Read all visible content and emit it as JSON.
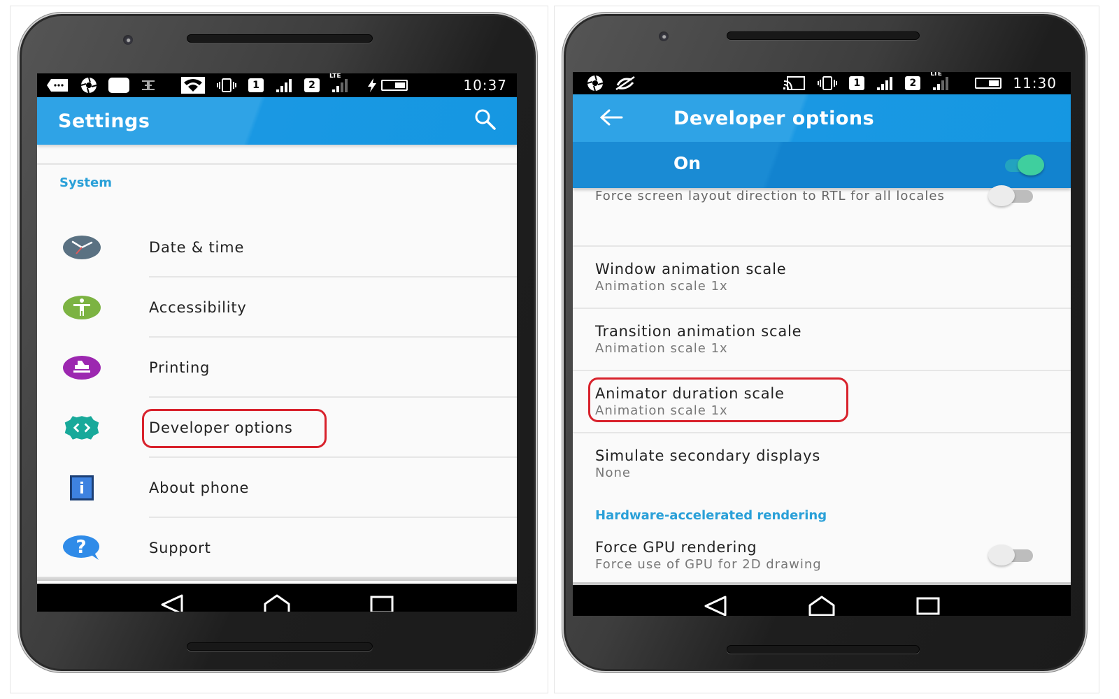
{
  "left_phone": {
    "status_bar": {
      "icons": [
        "more-icon",
        "aperture-icon",
        "blank-notification-icon",
        "usb-debug-icon",
        "wifi-icon",
        "vibrate-icon",
        "sim-1-icon",
        "signal-icon",
        "sim-2-icon",
        "lte-signal-icon",
        "charging-icon",
        "battery-icon"
      ],
      "sim1": "1",
      "sim2": "2",
      "lte": "LTE",
      "time": "10:37"
    },
    "app_bar": {
      "title": "Settings",
      "search_icon": "search-icon"
    },
    "section_header": "System",
    "items": [
      {
        "label": "Date & time",
        "icon": "clock-icon",
        "color": "#5a7182"
      },
      {
        "label": "Accessibility",
        "icon": "accessibility-icon",
        "color": "#7cb342"
      },
      {
        "label": "Printing",
        "icon": "printer-icon",
        "color": "#9c27b0"
      },
      {
        "label": "Developer options",
        "icon": "developer-options-icon",
        "color": "#18a99a",
        "highlighted": true
      },
      {
        "label": "About phone",
        "icon": "info-icon",
        "color": "#2d6bd0"
      },
      {
        "label": "Support",
        "icon": "help-icon",
        "color": "#2f8be8"
      }
    ],
    "nav": {
      "back": "back-icon",
      "home": "home-icon",
      "recents": "recents-icon"
    }
  },
  "right_phone": {
    "status_bar": {
      "icons": [
        "aperture-icon",
        "no-sync-icon",
        "cast-icon",
        "vibrate-icon",
        "sim-1-icon",
        "signal-icon",
        "sim-2-icon",
        "lte-signal-icon",
        "battery-icon"
      ],
      "sim1": "1",
      "sim2": "2",
      "lte": "LTE",
      "time": "11:30"
    },
    "app_bar": {
      "title": "Developer options",
      "back_icon": "back-arrow-icon"
    },
    "master_switch": {
      "label": "On",
      "enabled": true
    },
    "partial_item": {
      "title": "Force screen layout direction to RTL for all locales",
      "enabled": false
    },
    "prefs": [
      {
        "title": "Window animation scale",
        "summary": "Animation scale 1x"
      },
      {
        "title": "Transition animation scale",
        "summary": "Animation scale 1x"
      },
      {
        "title": "Animator duration scale",
        "summary": "Animation scale 1x",
        "highlighted": true
      },
      {
        "title": "Simulate secondary displays",
        "summary": "None"
      }
    ],
    "section_header": "Hardware-accelerated rendering",
    "gpu_pref": {
      "title": "Force GPU rendering",
      "summary": "Force use of GPU for 2D drawing",
      "enabled": false
    },
    "nav": {
      "back": "back-icon",
      "home": "home-icon",
      "recents": "recents-icon"
    }
  },
  "colors": {
    "app_bar": "#2fa3e6",
    "accent": "#2aa0d8",
    "highlight": "#d8222c",
    "switch_on": "#3fcf9e"
  }
}
